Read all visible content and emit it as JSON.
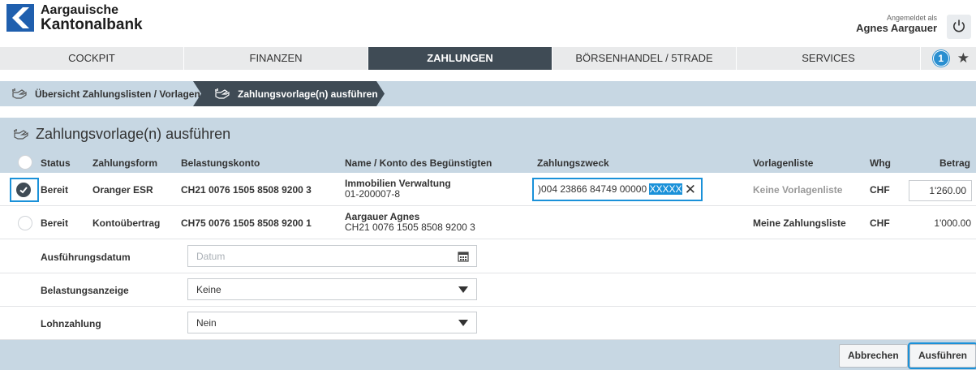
{
  "header": {
    "bank_line1": "Aargauische",
    "bank_line2": "Kantonalbank",
    "logged_in_label": "Angemeldet als",
    "user_name": "Agnes Aargauer"
  },
  "nav": {
    "tabs": [
      "COCKPIT",
      "FINANZEN",
      "ZAHLUNGEN",
      "BÖRSENHANDEL / 5TRADE",
      "SERVICES"
    ],
    "active": "ZAHLUNGEN",
    "notification_count": "1"
  },
  "breadcrumb": {
    "items": [
      "Übersicht Zahlungslisten / Vorlagen",
      "Zahlungsvorlage(n) ausführen"
    ]
  },
  "section": {
    "title": "Zahlungsvorlage(n) ausführen"
  },
  "table": {
    "columns": {
      "status": "Status",
      "zahlungsform": "Zahlungsform",
      "belastungskonto": "Belastungskonto",
      "beguenstigter": "Name / Konto des Begünstigten",
      "zahlungszweck": "Zahlungszweck",
      "vorlagenliste": "Vorlagenliste",
      "whg": "Whg",
      "betrag": "Betrag"
    },
    "rows": [
      {
        "selected": true,
        "status": "Bereit",
        "zahlungsform": "Oranger ESR",
        "belastungskonto": "CH21 0076 1505 8508 9200 3",
        "name": "Immobilien Verwaltung",
        "konto": "01-200007-8",
        "zweck_text": ")004 23866 84749 00000 ",
        "zweck_selected": "XXXXX",
        "vorlagenliste": "Keine Vorlagenliste",
        "whg": "CHF",
        "betrag": "1'260.00"
      },
      {
        "selected": false,
        "status": "Bereit",
        "zahlungsform": "Kontoübertrag",
        "belastungskonto": "CH75 0076 1505 8508 9200 1",
        "name": "Aargauer Agnes",
        "konto": "CH21 0076 1505 8508 9200 3",
        "zweck_text": "",
        "vorlagenliste": "Meine Zahlungsliste",
        "whg": "CHF",
        "betrag": "1'000.00"
      }
    ]
  },
  "form": {
    "ausfuehrungsdatum": {
      "label": "Ausführungsdatum",
      "placeholder": "Datum"
    },
    "belastungsanzeige": {
      "label": "Belastungsanzeige",
      "value": "Keine"
    },
    "lohnzahlung": {
      "label": "Lohnzahlung",
      "value": "Nein"
    }
  },
  "buttons": {
    "cancel": "Abbrechen",
    "execute": "Ausführen"
  },
  "colors": {
    "brand_blue": "#1f5fae",
    "nav_active": "#3f4b55",
    "panel_blue": "#c7d7e3",
    "focus_blue": "#1a91d9"
  }
}
